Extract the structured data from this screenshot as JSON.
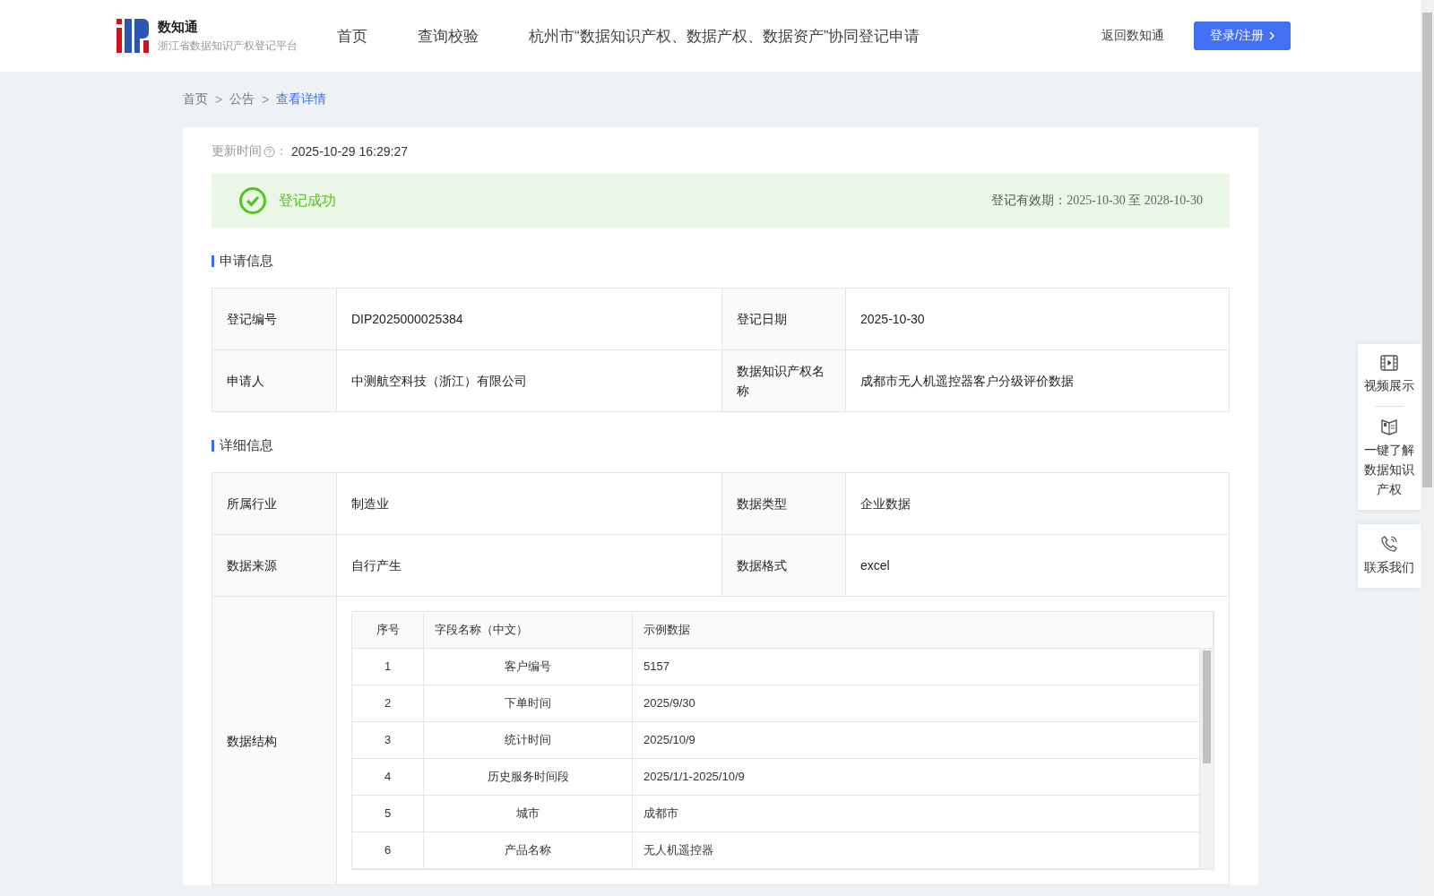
{
  "header": {
    "logo": {
      "title": "数知通",
      "subtitle": "浙江省数据知识产权登记平台"
    },
    "nav": [
      {
        "label": "首页",
        "selected": false
      },
      {
        "label": "查询校验",
        "selected": false
      },
      {
        "label": "杭州市“数据知识产权、数据产权、数据资产”协同登记申请",
        "selected": false
      }
    ],
    "back_link": "返回数知通",
    "login_button": "登录/注册"
  },
  "breadcrumb": [
    {
      "label": "首页",
      "current": false,
      "separator": ">"
    },
    {
      "label": "公告",
      "current": false,
      "separator": ">"
    },
    {
      "label": "查看详情",
      "current": true
    }
  ],
  "update": {
    "label": "更新时间",
    "suffix": "：",
    "value": "2025-10-29 16:29:27"
  },
  "status": {
    "kind": "success",
    "text": "登记成功",
    "validity_label": "登记有效期：",
    "validity": "2025-10-30 至 2028-10-30"
  },
  "sections": [
    {
      "title": "申请信息",
      "rows": [
        [
          {
            "label": "登记编号",
            "value": "DIP2025000025384"
          },
          {
            "label": "登记日期",
            "value": "2025-10-30"
          }
        ],
        [
          {
            "label": "申请人",
            "value": "中测航空科技（浙江）有限公司"
          },
          {
            "label": "数据知识产权名称",
            "value": "成都市无人机遥控器客户分级评价数据"
          }
        ]
      ]
    },
    {
      "title": "详细信息",
      "rows": [
        [
          {
            "label": "所属行业",
            "value": "制造业"
          },
          {
            "label": "数据类型",
            "value": "企业数据"
          }
        ],
        [
          {
            "label": "数据来源",
            "value": "自行产生"
          },
          {
            "label": "数据格式",
            "value": "excel"
          }
        ]
      ],
      "structure": {
        "label": "数据结构",
        "columns": [
          "序号",
          "字段名称（中文）",
          "示例数据"
        ],
        "rows": [
          [
            "1",
            "客户编号",
            "5157"
          ],
          [
            "2",
            "下单时间",
            "2025/9/30"
          ],
          [
            "3",
            "统计时间",
            "2025/10/9"
          ],
          [
            "4",
            "历史服务时间段",
            "2025/1/1-2025/10/9"
          ],
          [
            "5",
            "城市",
            "成都市"
          ],
          [
            "6",
            "产品名称",
            "无人机遥控器"
          ]
        ]
      }
    }
  ],
  "float_panels": [
    {
      "items": [
        {
          "kind": "video",
          "label": "视频展示"
        },
        {
          "kind": "book",
          "label": "一键了解数据知识产权"
        }
      ]
    },
    {
      "items": [
        {
          "kind": "phone",
          "label": "联系我们"
        }
      ]
    }
  ]
}
